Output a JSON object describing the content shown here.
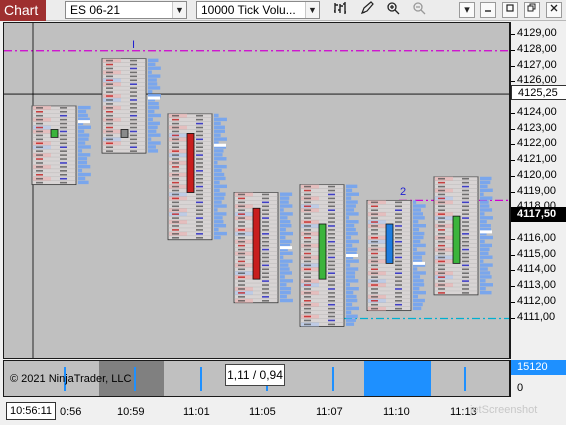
{
  "toolbar": {
    "chart_tab": "Chart",
    "instrument": "ES 06-21",
    "period": "10000 Tick Volu...",
    "icons": [
      "bar-style-icon",
      "pencil-icon",
      "zoom-in-icon",
      "zoom-out-icon"
    ],
    "window_buttons": [
      "dropdown",
      "minimize",
      "maximize",
      "close"
    ]
  },
  "price_axis": {
    "labels": [
      "4129,00",
      "4128,00",
      "4127,00",
      "4126,00",
      "4125,25",
      "4124,00",
      "4123,00",
      "4122,00",
      "4121,00",
      "4120,00",
      "4119,00",
      "4118,00",
      "4117,50",
      "4116,00",
      "4115,00",
      "4114,00",
      "4113,00",
      "4112,00",
      "4111,00"
    ],
    "crosshair_price": "4125,25",
    "last_price": "4117,50",
    "indicator_value": "15120",
    "indicator_zero": "0"
  },
  "chart_data": {
    "type": "candlestick",
    "price_range": [
      4110.5,
      4129.5
    ],
    "bars": [
      {
        "time": "10:56",
        "open": 4122.5,
        "close": 4123.0,
        "high": 4124.5,
        "low": 4119.5,
        "direction": "up",
        "poc": 4123.5
      },
      {
        "time": "10:58",
        "open": 4123.0,
        "close": 4122.5,
        "high": 4127.5,
        "low": 4121.5,
        "direction": "down",
        "poc": 4125.0
      },
      {
        "time": "10:59",
        "open": 4122.75,
        "close": 4119.0,
        "high": 4124.0,
        "low": 4116.0,
        "direction": "down",
        "poc": 4122.0
      },
      {
        "time": "11:02",
        "open": 4118.0,
        "close": 4113.5,
        "high": 4119.0,
        "low": 4112.0,
        "direction": "down",
        "poc": 4115.5
      },
      {
        "time": "11:05",
        "open": 4117.0,
        "close": 4113.5,
        "high": 4119.5,
        "low": 4110.5,
        "direction": "up",
        "poc": 4115.0
      },
      {
        "time": "11:08",
        "open": 4114.5,
        "close": 4117.0,
        "high": 4118.5,
        "low": 4111.5,
        "direction": "up",
        "poc": 4114.5
      },
      {
        "time": "11:11",
        "open": 4114.5,
        "close": 4117.5,
        "high": 4120.0,
        "low": 4112.5,
        "direction": "up",
        "poc": 4116.5
      }
    ],
    "hlines": [
      {
        "price": 4128.0,
        "color": "#d000d0",
        "style": "dash-dot"
      },
      {
        "price": 4118.5,
        "color": "#d000d0",
        "style": "dash-dot"
      },
      {
        "price": 4111.0,
        "color": "#00b0d0",
        "style": "dash-dot"
      }
    ],
    "annotations": [
      "I",
      "2"
    ],
    "indicator": {
      "name": "",
      "value": 15120,
      "highlight_blocks": [
        {
          "color": "#808080"
        },
        {
          "color": "#1e90ff"
        }
      ]
    }
  },
  "time_axis": {
    "current_time": "10:56:11",
    "labels": [
      "0:56",
      "10:59",
      "11:01",
      "11:05",
      "11:07",
      "11:10",
      "11:13"
    ]
  },
  "copyright": "© 2021 NinjaTrader, LLC",
  "ratio_box": "1,11 / 0,94",
  "watermark": "jetScreenshot"
}
